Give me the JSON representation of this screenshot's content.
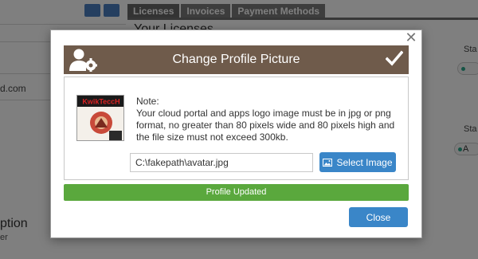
{
  "background": {
    "tabs": [
      {
        "label": "Licenses",
        "active": true
      },
      {
        "label": "Invoices",
        "active": false
      },
      {
        "label": "Payment Methods",
        "active": false
      }
    ],
    "section_title": "Your Licenses",
    "email_fragment": "d.com",
    "sidebar_label": "ption",
    "sidebar_sub": "er",
    "right_labels": [
      "Sta",
      "Sta"
    ],
    "pill_labels": [
      "",
      "A"
    ]
  },
  "modal": {
    "title": "Change Profile Picture",
    "header_icon": "user-settings-icon",
    "confirm_icon": "checkmark-icon",
    "close_icon": "close-icon",
    "logo_text": "KwikTeccH",
    "note_title": "Note:",
    "note_body": "Your cloud portal and apps logo image must be in jpg or png format, no greater than 80 pixels wide and 80 pixels high and the file size must not exceed 300kb.",
    "file_path_value": "C:\\fakepath\\avatar.jpg",
    "select_image_label": "Select Image",
    "select_image_icon": "image-icon",
    "status_message": "Profile Updated",
    "close_label": "Close"
  },
  "colors": {
    "header_bg": "#6f5b4b",
    "primary_button": "#3a86c8",
    "success_bar": "#5aa83d"
  }
}
